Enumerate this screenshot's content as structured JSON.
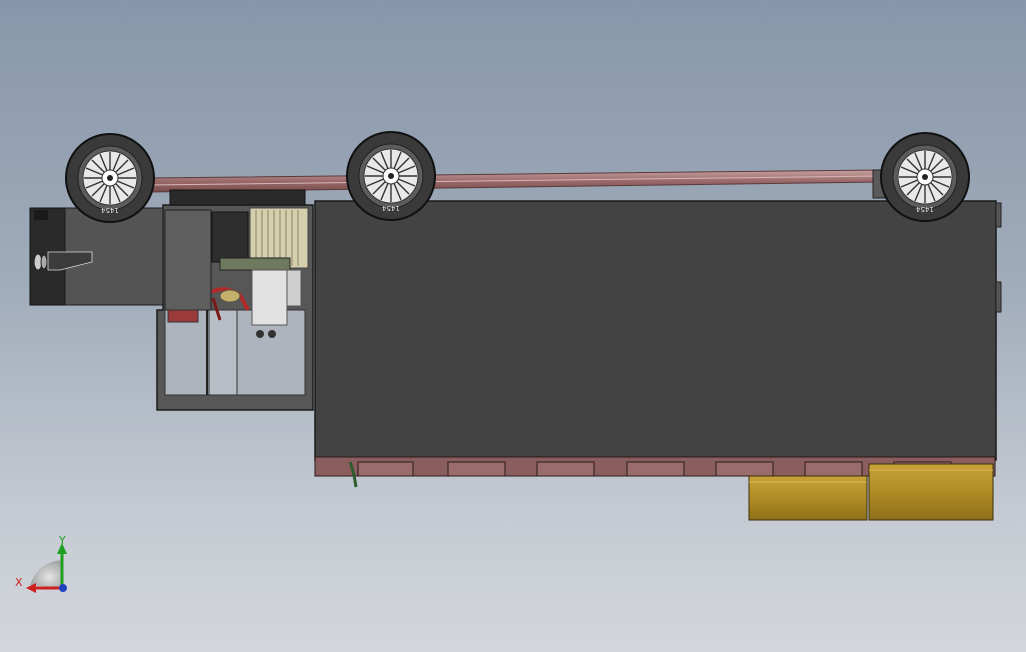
{
  "viewport": {
    "model": "truck-assembly",
    "view": "top"
  },
  "triad": {
    "x_label": "X",
    "y_label": "Y",
    "x_color": "#cc2020",
    "y_color": "#20a020",
    "z_color": "#2040c0"
  },
  "colors": {
    "body": "#424242",
    "body_edge": "#1c1c1c",
    "frame_rail": "#a87878",
    "tire": "#3a3a3a",
    "tank": "#b8962c",
    "crossmember": "#8a5e5e"
  },
  "wheels": [
    {
      "name": "wheel-front",
      "tire_text": "1454"
    },
    {
      "name": "wheel-middle",
      "tire_text": "1454"
    },
    {
      "name": "wheel-rear",
      "tire_text": "1454"
    }
  ]
}
